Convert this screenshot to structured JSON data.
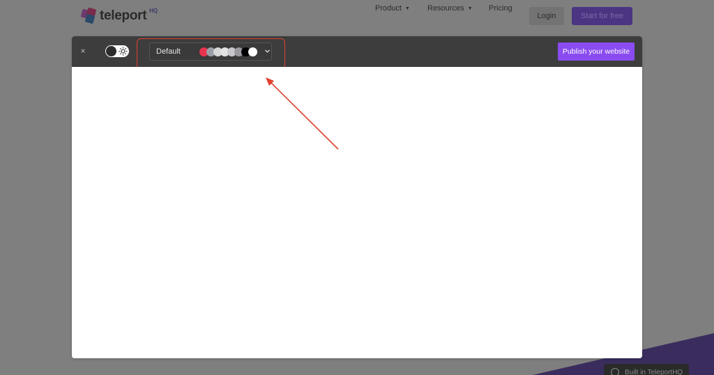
{
  "site": {
    "logo_text": "teleport",
    "logo_sup": "HQ",
    "nav": [
      {
        "label": "Product",
        "has_caret": true
      },
      {
        "label": "Resources",
        "has_caret": true
      },
      {
        "label": "Pricing",
        "has_caret": false
      }
    ],
    "login_label": "Login",
    "start_label": "Start for free",
    "built_badge_label": "Built in TeleportHQ"
  },
  "toolbar": {
    "close_glyph": "×",
    "theme_toggle": {
      "state": "light",
      "icon": "sun-icon"
    },
    "palette": {
      "label": "Default",
      "swatch_colors": [
        "#e8344e",
        "#9aa0a6",
        "#d8d8d8",
        "#e2e2e2",
        "#c8c8cc",
        "#9a9aa0",
        "#000000",
        "#ffffff"
      ]
    },
    "publish_label": "Publish your website"
  },
  "colors": {
    "accent": "#8a4cf0",
    "annotation": "#e0402e"
  }
}
